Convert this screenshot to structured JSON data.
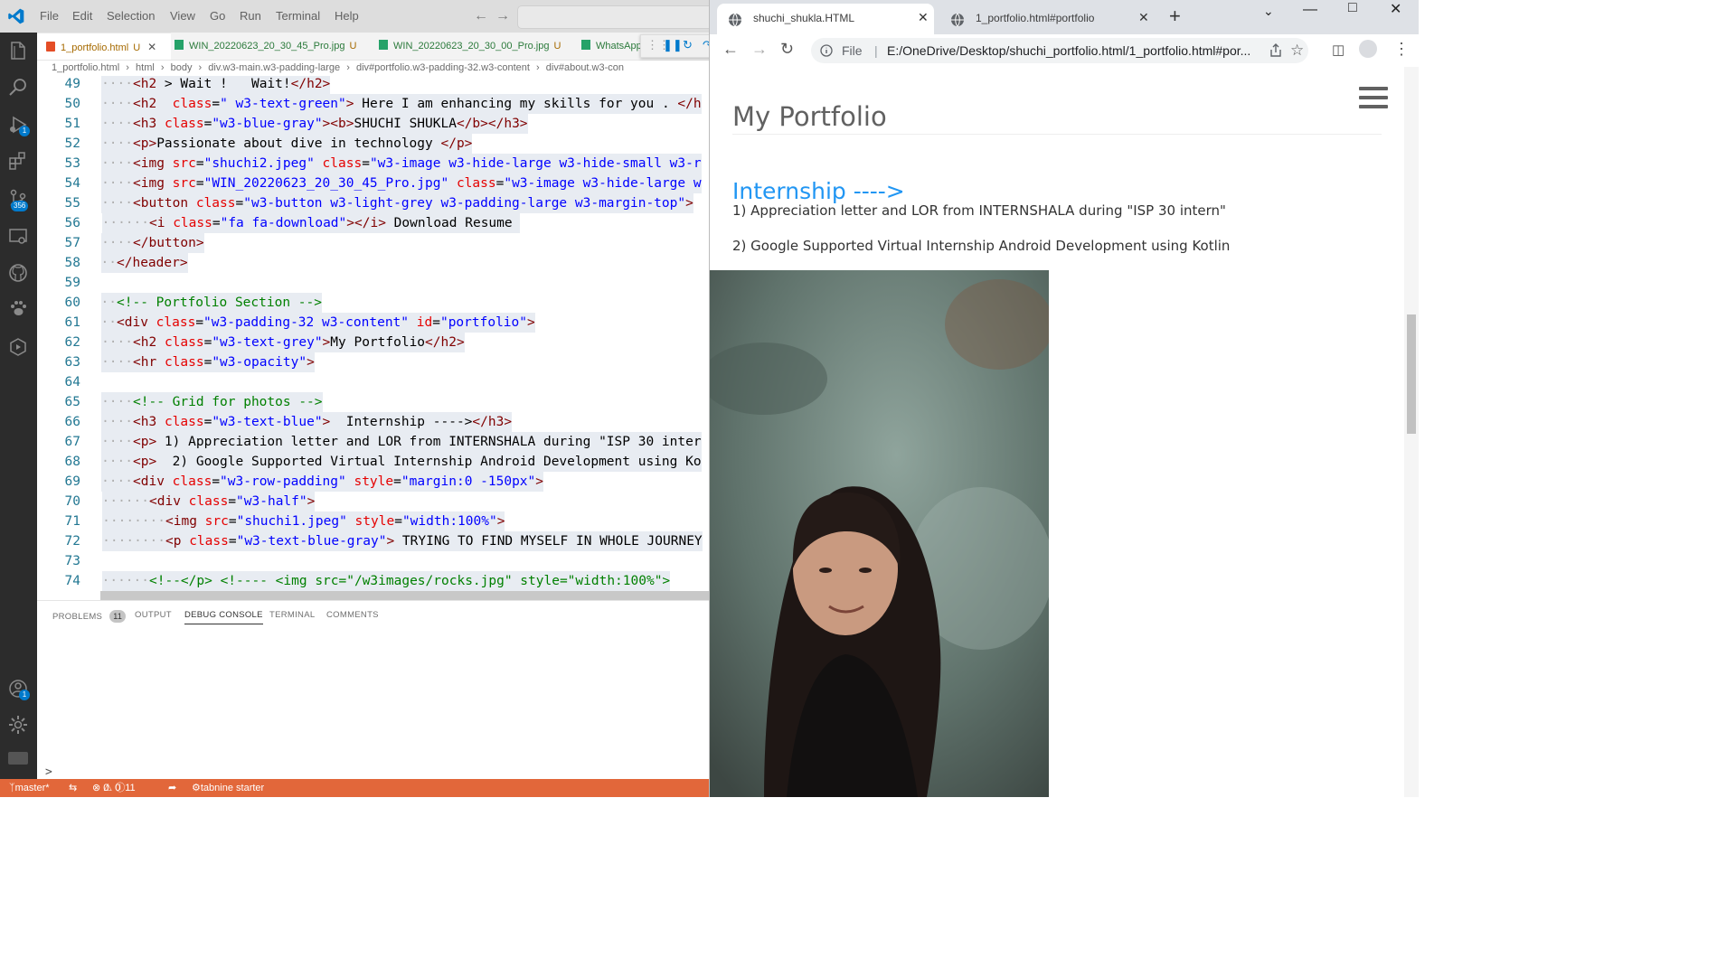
{
  "vscode": {
    "menu": [
      "File",
      "Edit",
      "Selection",
      "View",
      "Go",
      "Run",
      "Terminal",
      "Help"
    ],
    "tabs": [
      {
        "label": "1_portfolio.html",
        "mark": "U",
        "active": true
      },
      {
        "label": "WIN_20220623_20_30_45_Pro.jpg",
        "mark": "U"
      },
      {
        "label": "WIN_20220623_20_30_00_Pro.jpg",
        "mark": "U"
      },
      {
        "label": "WhatsApp"
      }
    ],
    "breadcrumb": [
      "1_portfolio.html",
      "html",
      "body",
      "div.w3-main.w3-padding-large",
      "div#portfolio.w3-padding-32.w3-content",
      "div#about.w3-con"
    ],
    "badges": {
      "debug": "1",
      "source_control": "356",
      "accounts": "1"
    },
    "panel": {
      "tabs": [
        "PROBLEMS",
        "OUTPUT",
        "DEBUG CONSOLE",
        "TERMINAL",
        "COMMENTS"
      ],
      "problems_count": "11",
      "active_tab": "DEBUG CONSOLE",
      "prompt": ">"
    },
    "status": {
      "branch": "master*",
      "errors": "0",
      "warnings": "0",
      "info": "11",
      "extension": "tabnine starter"
    },
    "colors": {
      "statusbar": "#e2673a",
      "activitybar": "#2c2c2c",
      "accent": "#007acc"
    },
    "lines": [
      {
        "n": "49",
        "indent": 2,
        "parts": [
          [
            "tg",
            "<h2"
          ],
          [
            "tx",
            " > Wait ! "
          ],
          [
            "tx",
            "  Wait!"
          ],
          [
            "tg",
            "</h2>"
          ]
        ]
      },
      {
        "n": "50",
        "indent": 2,
        "parts": [
          [
            "tg",
            "<h2"
          ],
          [
            "tx",
            "  "
          ],
          [
            "at",
            "class"
          ],
          [
            "tx",
            "="
          ],
          [
            "st",
            "\" w3-text-green\""
          ],
          [
            "tg",
            ">"
          ],
          [
            "tx",
            " Here I am enhancing my skills for you . "
          ],
          [
            "tg",
            "</h"
          ]
        ]
      },
      {
        "n": "51",
        "indent": 2,
        "parts": [
          [
            "tg",
            "<h3"
          ],
          [
            "tx",
            " "
          ],
          [
            "at",
            "class"
          ],
          [
            "tx",
            "="
          ],
          [
            "st",
            "\"w3-blue-gray\""
          ],
          [
            "tg",
            "><b>"
          ],
          [
            "tx",
            "SHUCHI SHUKLA"
          ],
          [
            "tg",
            "</b></h3>"
          ]
        ]
      },
      {
        "n": "52",
        "indent": 2,
        "parts": [
          [
            "tg",
            "<p>"
          ],
          [
            "tx",
            "Passionate about dive in technology "
          ],
          [
            "tg",
            "</p>"
          ]
        ]
      },
      {
        "n": "53",
        "indent": 2,
        "parts": [
          [
            "tg",
            "<img"
          ],
          [
            "tx",
            " "
          ],
          [
            "at",
            "src"
          ],
          [
            "tx",
            "="
          ],
          [
            "st",
            "\"shuchi2.jpeg\""
          ],
          [
            "tx",
            " "
          ],
          [
            "at",
            "class"
          ],
          [
            "tx",
            "="
          ],
          [
            "st",
            "\"w3-image w3-hide-large w3-hide-small w3-r"
          ]
        ]
      },
      {
        "n": "54",
        "indent": 2,
        "parts": [
          [
            "tg",
            "<img"
          ],
          [
            "tx",
            " "
          ],
          [
            "at",
            "src"
          ],
          [
            "tx",
            "="
          ],
          [
            "st",
            "\"WIN_20220623_20_30_45_Pro.jpg\""
          ],
          [
            "tx",
            " "
          ],
          [
            "at",
            "class"
          ],
          [
            "tx",
            "="
          ],
          [
            "st",
            "\"w3-image w3-hide-large w"
          ]
        ]
      },
      {
        "n": "55",
        "indent": 2,
        "parts": [
          [
            "tg",
            "<button"
          ],
          [
            "tx",
            " "
          ],
          [
            "at",
            "class"
          ],
          [
            "tx",
            "="
          ],
          [
            "st",
            "\"w3-button w3-light-grey w3-padding-large w3-margin-top\""
          ],
          [
            "tg",
            ">"
          ]
        ]
      },
      {
        "n": "56",
        "indent": 3,
        "parts": [
          [
            "tg",
            "<i"
          ],
          [
            "tx",
            " "
          ],
          [
            "at",
            "class"
          ],
          [
            "tx",
            "="
          ],
          [
            "st",
            "\"fa fa-download\""
          ],
          [
            "tg",
            "></i>"
          ],
          [
            "tx",
            " Download Resume "
          ]
        ]
      },
      {
        "n": "57",
        "indent": 2,
        "parts": [
          [
            "tg",
            "</button>"
          ]
        ]
      },
      {
        "n": "58",
        "indent": 1,
        "parts": [
          [
            "tg",
            "</header>"
          ]
        ]
      },
      {
        "n": "59",
        "indent": 0,
        "parts": []
      },
      {
        "n": "60",
        "indent": 1,
        "parts": [
          [
            "cm",
            "<!-- Portfolio Section -->"
          ]
        ]
      },
      {
        "n": "61",
        "indent": 1,
        "parts": [
          [
            "tg",
            "<div"
          ],
          [
            "tx",
            " "
          ],
          [
            "at",
            "class"
          ],
          [
            "tx",
            "="
          ],
          [
            "st",
            "\"w3-padding-32 w3-content\""
          ],
          [
            "tx",
            " "
          ],
          [
            "at",
            "id"
          ],
          [
            "tx",
            "="
          ],
          [
            "st",
            "\"portfolio\""
          ],
          [
            "tg",
            ">"
          ]
        ]
      },
      {
        "n": "62",
        "indent": 2,
        "parts": [
          [
            "tg",
            "<h2"
          ],
          [
            "tx",
            " "
          ],
          [
            "at",
            "class"
          ],
          [
            "tx",
            "="
          ],
          [
            "st",
            "\"w3-text-grey\""
          ],
          [
            "tg",
            ">"
          ],
          [
            "tx",
            "My Portfolio"
          ],
          [
            "tg",
            "</h2>"
          ]
        ]
      },
      {
        "n": "63",
        "indent": 2,
        "parts": [
          [
            "tg",
            "<hr"
          ],
          [
            "tx",
            " "
          ],
          [
            "at",
            "class"
          ],
          [
            "tx",
            "="
          ],
          [
            "st",
            "\"w3-opacity\""
          ],
          [
            "tg",
            ">"
          ]
        ]
      },
      {
        "n": "64",
        "indent": 0,
        "parts": []
      },
      {
        "n": "65",
        "indent": 2,
        "parts": [
          [
            "cm",
            "<!-- Grid for photos -->"
          ]
        ]
      },
      {
        "n": "66",
        "indent": 2,
        "parts": [
          [
            "tg",
            "<h3"
          ],
          [
            "tx",
            " "
          ],
          [
            "at",
            "class"
          ],
          [
            "tx",
            "="
          ],
          [
            "st",
            "\"w3-text-blue\""
          ],
          [
            "tg",
            ">"
          ],
          [
            "tx",
            "  Internship ---->"
          ],
          [
            "tg",
            "</h3>"
          ]
        ]
      },
      {
        "n": "67",
        "indent": 2,
        "parts": [
          [
            "tg",
            "<p>"
          ],
          [
            "tx",
            " 1) Appreciation letter and LOR from INTERNSHALA during \"ISP 30 inter"
          ]
        ]
      },
      {
        "n": "68",
        "indent": 2,
        "parts": [
          [
            "tg",
            "<p>"
          ],
          [
            "tx",
            "  2) Google Supported Virtual Internship Android Development using Ko"
          ]
        ]
      },
      {
        "n": "69",
        "indent": 2,
        "parts": [
          [
            "tg",
            "<div"
          ],
          [
            "tx",
            " "
          ],
          [
            "at",
            "class"
          ],
          [
            "tx",
            "="
          ],
          [
            "st",
            "\"w3-row-padding\""
          ],
          [
            "tx",
            " "
          ],
          [
            "at",
            "style"
          ],
          [
            "tx",
            "="
          ],
          [
            "st",
            "\"margin:0 -150px\""
          ],
          [
            "tg",
            ">"
          ]
        ]
      },
      {
        "n": "70",
        "indent": 3,
        "parts": [
          [
            "tg",
            "<div"
          ],
          [
            "tx",
            " "
          ],
          [
            "at",
            "class"
          ],
          [
            "tx",
            "="
          ],
          [
            "st",
            "\"w3-half\""
          ],
          [
            "tg",
            ">"
          ]
        ]
      },
      {
        "n": "71",
        "indent": 4,
        "parts": [
          [
            "tg",
            "<img"
          ],
          [
            "tx",
            " "
          ],
          [
            "at",
            "src"
          ],
          [
            "tx",
            "="
          ],
          [
            "st",
            "\"shuchi1.jpeg\""
          ],
          [
            "tx",
            " "
          ],
          [
            "at",
            "style"
          ],
          [
            "tx",
            "="
          ],
          [
            "st",
            "\"width:100%\""
          ],
          [
            "tg",
            ">"
          ]
        ]
      },
      {
        "n": "72",
        "indent": 4,
        "parts": [
          [
            "tg",
            "<p"
          ],
          [
            "tx",
            " "
          ],
          [
            "at",
            "class"
          ],
          [
            "tx",
            "="
          ],
          [
            "st",
            "\"w3-text-blue-gray\""
          ],
          [
            "tg",
            ">"
          ],
          [
            "tx",
            " TRYING TO FIND MYSELF IN WHOLE JOURNEY"
          ]
        ]
      },
      {
        "n": "73",
        "indent": 0,
        "parts": []
      },
      {
        "n": "74",
        "indent": 3,
        "parts": [
          [
            "cm",
            "<!--</p> <!---- <img src=\"/w3images/rocks.jpg\" style=\"width:100%\">"
          ]
        ]
      }
    ]
  },
  "browser": {
    "tabs": [
      {
        "label": "shuchi_shukla.HTML",
        "active": true
      },
      {
        "label": "1_portfolio.html#portfolio"
      }
    ],
    "url_scheme": "File",
    "url_sep": "|",
    "url": "E:/OneDrive/Desktop/shuchi_portfolio.html/1_portfolio.html#por...",
    "page": {
      "heading": "My Portfolio",
      "internship_heading": "Internship ---->",
      "items": [
        "1) Appreciation letter and LOR from INTERNSHALA during \"ISP 30 intern\"",
        "2) Google Supported Virtual Internship Android Development using Kotlin"
      ]
    },
    "colors": {
      "heading": "#616161",
      "link_blue": "#2196F3"
    }
  }
}
